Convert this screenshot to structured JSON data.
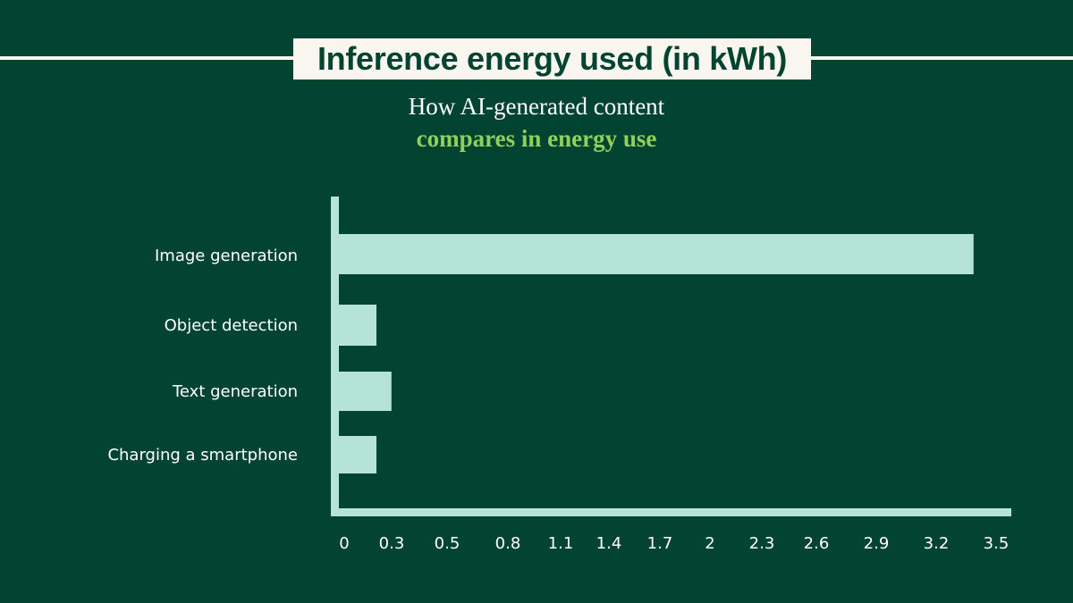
{
  "header": {
    "title": "Inference energy used (in kWh)",
    "subtitle_line1": "How AI-generated content",
    "subtitle_line2": "compares in energy use"
  },
  "colors": {
    "background": "#034332",
    "bar": "#b5e3d8",
    "title_box": "#f8f6ee",
    "accent": "#8fd05c",
    "text": "#ffffff"
  },
  "chart_data": {
    "type": "bar",
    "orientation": "horizontal",
    "title": "Inference energy used (in kWh)",
    "subtitle": "How AI-generated content compares in energy use",
    "xlabel": "",
    "ylabel": "",
    "categories": [
      "Image generation",
      "Object detection",
      "Text generation",
      "Charging a smartphone"
    ],
    "values": [
      3.38,
      0.2,
      0.28,
      0.2
    ],
    "x_ticks": [
      "0",
      "0.3",
      "0.5",
      "0.8",
      "1.1",
      "1.4",
      "1.7",
      "2",
      "2.3",
      "2.6",
      "2.9",
      "3.2",
      "3.5"
    ],
    "xlim": [
      0,
      3.5
    ],
    "grid": false,
    "legend": "none"
  }
}
